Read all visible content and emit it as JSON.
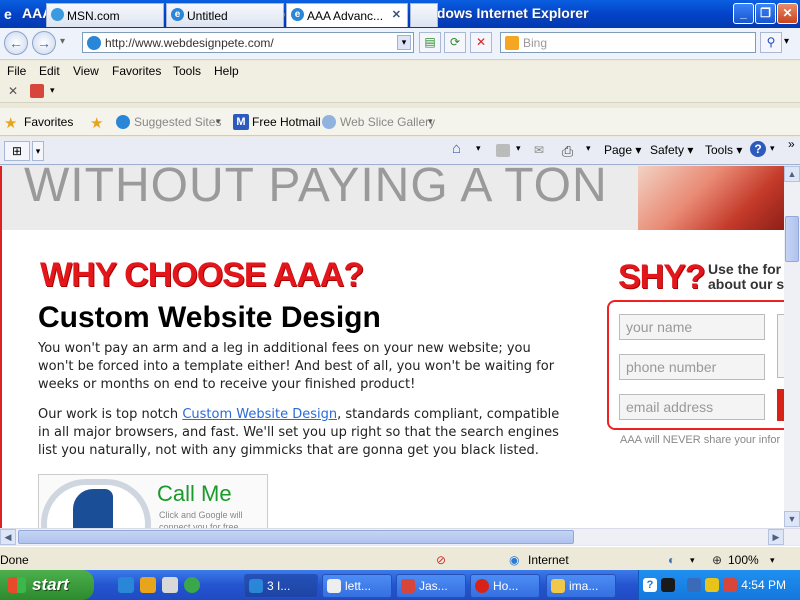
{
  "window": {
    "title": "AAA Advanced - THE Website Design Guys 801.440.1550 - Windows Internet Explorer"
  },
  "address": {
    "value": "http://www.webdesignpete.com/",
    "search_placeholder": "Bing"
  },
  "menu": [
    "File",
    "Edit",
    "View",
    "Favorites",
    "Tools",
    "Help"
  ],
  "favorites_bar": {
    "favorites": "Favorites",
    "suggested": "Suggested Sites",
    "hotmail": "Free Hotmail",
    "slice": "Web Slice Gallery"
  },
  "tabs": [
    {
      "label": "MSN.com"
    },
    {
      "label": "Untitled"
    },
    {
      "label": "AAA Advanc..."
    }
  ],
  "toolbar": {
    "page": "Page",
    "safety": "Safety",
    "tools": "Tools"
  },
  "page": {
    "hero_text": "WITHOUT PAYING A TON",
    "why_heading": "WHY CHOOSE AAA?",
    "cwd_heading": "Custom Website Design",
    "para1": "You won't pay an arm and a leg in additional fees on your new website; you won't be forced into a template either! And best of all, you won't be waiting for weeks or months on end to receive your finished product!",
    "para2_before": "Our work is top notch ",
    "para2_link": "Custom Website Design",
    "para2_after": ", standards compliant, compatible in all major browsers, and fast. We'll set you up right so that the search engines list you naturally, not with any gimmicks that are gonna get you black listed.",
    "call_title": "Call Me",
    "call_sub": "Click and Google will connect you for free.",
    "shy_heading": "SHY?",
    "shy_sub1": "Use the for",
    "shy_sub2": "about our s",
    "form": {
      "name": "your name",
      "phone": "phone number",
      "email": "email address"
    },
    "never_share": "AAA will NEVER share your infor"
  },
  "status": {
    "text": "Done",
    "zone": "Internet",
    "zoom": "100%"
  },
  "taskbar": {
    "start": "start",
    "tasks": [
      "3 I...",
      "lett...",
      "Jas...",
      "Ho...",
      "ima..."
    ],
    "clock": "4:54 PM"
  }
}
